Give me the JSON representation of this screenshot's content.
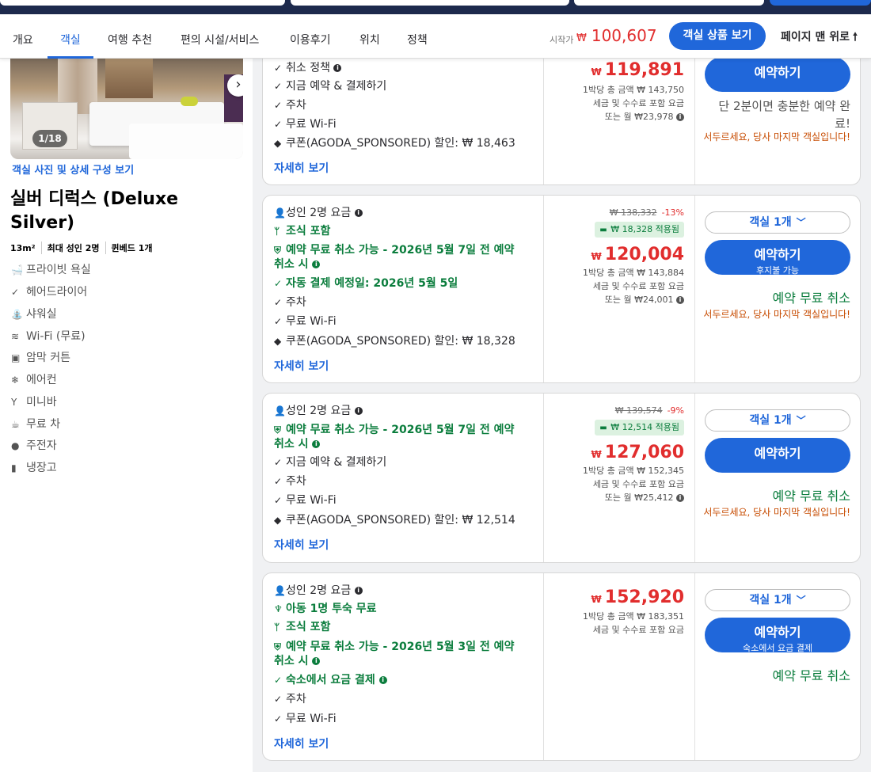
{
  "nav": {
    "tabs": [
      {
        "label": "개요"
      },
      {
        "label": "객실"
      },
      {
        "label": "여행 추천"
      },
      {
        "label": "편의 시설/서비스"
      },
      {
        "label": "이용후기"
      },
      {
        "label": "위치"
      },
      {
        "label": "정책"
      }
    ],
    "start_label": "시작가",
    "start_currency": "₩",
    "start_price": "100,607",
    "view_button": "객실 상품 보기",
    "to_top": "페이지 맨 위로",
    "to_top_icon": "arrow-up-icon"
  },
  "room": {
    "photo_counter": "1/18",
    "photo_link": "객실 사진 및 상세 구성 보기",
    "name": "실버 디럭스 (Deluxe Silver)",
    "specs": [
      "13m²",
      "최대 성인 2명",
      "퀸베드 1개"
    ],
    "amenities": [
      {
        "label": "프라이빗 욕실",
        "icon": "bathtub-icon"
      },
      {
        "label": "헤어드라이어",
        "icon": "check-icon"
      },
      {
        "label": "샤워실",
        "icon": "shower-icon"
      },
      {
        "label": "Wi-Fi (무료)",
        "icon": "wifi-icon"
      },
      {
        "label": "암막 커튼",
        "icon": "curtain-icon"
      },
      {
        "label": "에어컨",
        "icon": "snowflake-icon"
      },
      {
        "label": "미니바",
        "icon": "cocktail-icon"
      },
      {
        "label": "무료 차",
        "icon": "tea-icon"
      },
      {
        "label": "주전자",
        "icon": "kettle-icon"
      },
      {
        "label": "냉장고",
        "icon": "fridge-icon"
      }
    ]
  },
  "offers": [
    {
      "features": [
        {
          "text": "취소 정책",
          "green": false,
          "icon": "check-icon",
          "info": true
        },
        {
          "text": "지금 예약 & 결제하기",
          "green": false,
          "icon": "check-icon",
          "info": false
        },
        {
          "text": "주차",
          "green": false,
          "icon": "check-icon",
          "info": false
        },
        {
          "text": "무료 Wi-Fi",
          "green": false,
          "icon": "check-icon",
          "info": false
        },
        {
          "text": "쿠폰(AGODA_SPONSORED) 할인: ₩ 18,463",
          "green": false,
          "icon": "tag-icon",
          "info": false
        }
      ],
      "more": "자세히 보기",
      "price_currency": "₩",
      "price": "119,891",
      "sub": [
        "1박당 총 금액 ₩ 143,750",
        "세금 및 수수료 포함 요금",
        "또는 월 ₩23,978"
      ],
      "book_label": "예약하기",
      "done_text": "단 2분이면 충분한 예약 완료!",
      "hurry": "서두르세요, 당사 마지막 객실입니다!"
    },
    {
      "features": [
        {
          "text": "성인 2명 요금",
          "green": false,
          "icon": "person-icon",
          "info": true
        },
        {
          "text": "조식 포함",
          "green": true,
          "icon": "fork-knife-icon",
          "info": false
        },
        {
          "text": "예약 무료 취소 가능 - 2026년 5월 7일 전 예약 취소 시",
          "green": true,
          "icon": "shield-icon",
          "info": true
        },
        {
          "text": "자동 결제 예정일: 2026년 5월 5일",
          "green": true,
          "icon": "check-icon",
          "info": false
        },
        {
          "text": "주차",
          "green": false,
          "icon": "check-icon",
          "info": false
        },
        {
          "text": "무료 Wi-Fi",
          "green": false,
          "icon": "check-icon",
          "info": false
        },
        {
          "text": "쿠폰(AGODA_SPONSORED) 할인: ₩ 18,328",
          "green": false,
          "icon": "tag-icon",
          "info": false
        }
      ],
      "more": "자세히 보기",
      "strike": "₩ 138,332",
      "pct": "-13%",
      "promo": "₩ 18,328 적용됨",
      "price_currency": "₩",
      "price": "120,004",
      "sub": [
        "1박당 총 금액 ₩ 143,884",
        "세금 및 수수료 포함 요금",
        "또는 월 ₩24,001"
      ],
      "room_select": "객실 1개",
      "book_label": "예약하기",
      "book_sub": "후지불 가능",
      "free_cancel": "예약 무료 취소",
      "hurry": "서두르세요, 당사 마지막 객실입니다!"
    },
    {
      "features": [
        {
          "text": "성인 2명 요금",
          "green": false,
          "icon": "person-icon",
          "info": true
        },
        {
          "text": "예약 무료 취소 가능 - 2026년 5월 7일 전 예약 취소 시",
          "green": true,
          "icon": "shield-icon",
          "info": true
        },
        {
          "text": "지금 예약 & 결제하기",
          "green": false,
          "icon": "check-icon",
          "info": false
        },
        {
          "text": "주차",
          "green": false,
          "icon": "check-icon",
          "info": false
        },
        {
          "text": "무료 Wi-Fi",
          "green": false,
          "icon": "check-icon",
          "info": false
        },
        {
          "text": "쿠폰(AGODA_SPONSORED) 할인: ₩ 12,514",
          "green": false,
          "icon": "tag-icon",
          "info": false
        }
      ],
      "more": "자세히 보기",
      "strike": "₩ 139,574",
      "pct": "-9%",
      "promo": "₩ 12,514 적용됨",
      "price_currency": "₩",
      "price": "127,060",
      "sub": [
        "1박당 총 금액 ₩ 152,345",
        "세금 및 수수료 포함 요금",
        "또는 월 ₩25,412"
      ],
      "room_select": "객실 1개",
      "book_label": "예약하기",
      "free_cancel": "예약 무료 취소",
      "hurry": "서두르세요, 당사 마지막 객실입니다!"
    },
    {
      "features": [
        {
          "text": "성인 2명 요금",
          "green": false,
          "icon": "person-icon",
          "info": true
        },
        {
          "text": "아동 1명 투숙 무료",
          "green": true,
          "icon": "child-icon",
          "info": false
        },
        {
          "text": "조식 포함",
          "green": true,
          "icon": "fork-knife-icon",
          "info": false
        },
        {
          "text": "예약 무료 취소 가능 - 2026년 5월 3일 전 예약 취소 시",
          "green": true,
          "icon": "shield-icon",
          "info": true
        },
        {
          "text": "숙소에서 요금 결제",
          "green": true,
          "icon": "check-icon",
          "info": true
        },
        {
          "text": "주차",
          "green": false,
          "icon": "check-icon",
          "info": false
        },
        {
          "text": "무료 Wi-Fi",
          "green": false,
          "icon": "check-icon",
          "info": false
        }
      ],
      "more": "자세히 보기",
      "price_currency": "₩",
      "price": "152,920",
      "sub": [
        "1박당 총 금액 ₩ 183,351",
        "세금 및 수수료 포함 요금"
      ],
      "room_select": "객실 1개",
      "book_label": "예약하기",
      "book_sub": "숙소에서 요금 결제",
      "free_cancel": "예약 무료 취소"
    }
  ]
}
